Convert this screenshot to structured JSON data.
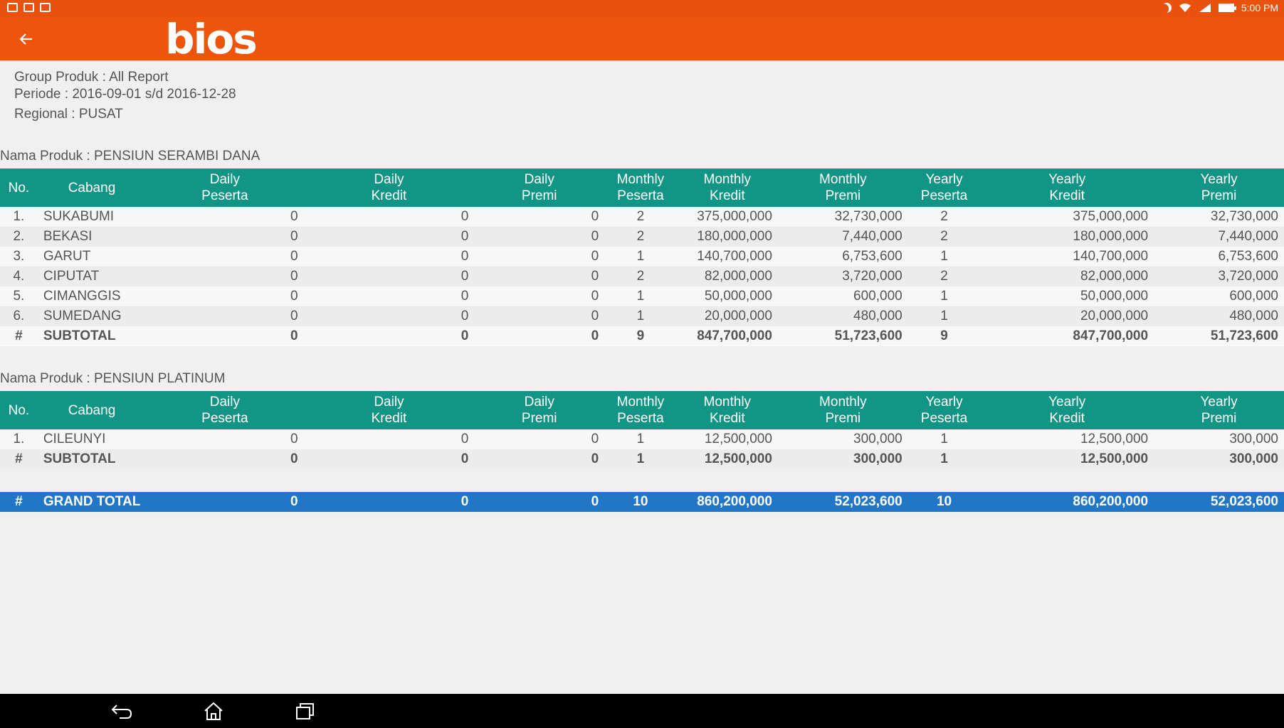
{
  "status_bar": {
    "time": "5:00 PM"
  },
  "app": {
    "logo_text": "bios",
    "back_icon": "arrow-left-icon"
  },
  "info": {
    "group_produk": "Group Produk : All Report",
    "periode": "Periode : 2016-09-01 s/d 2016-12-28",
    "regional": "Regional : PUSAT"
  },
  "columns": [
    [
      "No.",
      ""
    ],
    [
      "Cabang",
      ""
    ],
    [
      "Daily",
      "Peserta"
    ],
    [
      "Daily",
      "Kredit"
    ],
    [
      "Daily",
      "Premi"
    ],
    [
      "Monthly",
      "Peserta"
    ],
    [
      "Monthly",
      "Kredit"
    ],
    [
      "Monthly",
      "Premi"
    ],
    [
      "Yearly",
      "Peserta"
    ],
    [
      "Yearly",
      "Kredit"
    ],
    [
      "Yearly",
      "Premi"
    ]
  ],
  "sections": [
    {
      "title": "Nama Produk : PENSIUN SERAMBI DANA",
      "rows": [
        [
          "1.",
          "SUKABUMI",
          "0",
          "0",
          "0",
          "2",
          "375,000,000",
          "32,730,000",
          "2",
          "375,000,000",
          "32,730,000"
        ],
        [
          "2.",
          "BEKASI",
          "0",
          "0",
          "0",
          "2",
          "180,000,000",
          "7,440,000",
          "2",
          "180,000,000",
          "7,440,000"
        ],
        [
          "3.",
          "GARUT",
          "0",
          "0",
          "0",
          "1",
          "140,700,000",
          "6,753,600",
          "1",
          "140,700,000",
          "6,753,600"
        ],
        [
          "4.",
          "CIPUTAT",
          "0",
          "0",
          "0",
          "2",
          "82,000,000",
          "3,720,000",
          "2",
          "82,000,000",
          "3,720,000"
        ],
        [
          "5.",
          "CIMANGGIS",
          "0",
          "0",
          "0",
          "1",
          "50,000,000",
          "600,000",
          "1",
          "50,000,000",
          "600,000"
        ],
        [
          "6.",
          "SUMEDANG",
          "0",
          "0",
          "0",
          "1",
          "20,000,000",
          "480,000",
          "1",
          "20,000,000",
          "480,000"
        ]
      ],
      "subtotal": [
        "#",
        "SUBTOTAL",
        "0",
        "0",
        "0",
        "9",
        "847,700,000",
        "51,723,600",
        "9",
        "847,700,000",
        "51,723,600"
      ]
    },
    {
      "title": "Nama Produk : PENSIUN PLATINUM",
      "rows": [
        [
          "1.",
          "CILEUNYI",
          "0",
          "0",
          "0",
          "1",
          "12,500,000",
          "300,000",
          "1",
          "12,500,000",
          "300,000"
        ]
      ],
      "subtotal": [
        "#",
        "SUBTOTAL",
        "0",
        "0",
        "0",
        "1",
        "12,500,000",
        "300,000",
        "1",
        "12,500,000",
        "300,000"
      ]
    }
  ],
  "grand_total": [
    "#",
    "GRAND TOTAL",
    "0",
    "0",
    "0",
    "10",
    "860,200,000",
    "52,023,600",
    "10",
    "860,200,000",
    "52,023,600"
  ],
  "nav_icons": [
    "back-icon",
    "home-icon",
    "recent-apps-icon"
  ],
  "colors": {
    "app_bar": "#ef540d",
    "table_header": "#129585",
    "grand_total": "#2176c8"
  }
}
